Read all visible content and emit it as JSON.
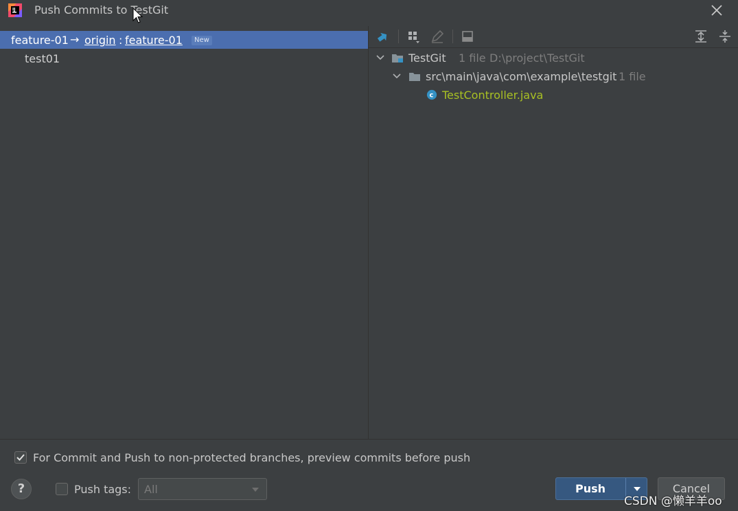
{
  "window": {
    "title": "Push Commits to TestGit",
    "close_icon": "close-icon",
    "app_icon": "intellij-idea-icon"
  },
  "commits_panel": {
    "branch": {
      "local": "feature-01",
      "arrow": "→",
      "remote": "origin",
      "separator": ":",
      "target": "feature-01",
      "badge": "New"
    },
    "commits": [
      "test01"
    ]
  },
  "changes_panel": {
    "toolbar_icons": [
      "show-diff-icon",
      "group-by-icon",
      "edit-source-icon",
      "view-options-icon",
      "expand-all-icon",
      "collapse-all-icon"
    ],
    "tree": {
      "root": {
        "name": "TestGit",
        "count": "1 file",
        "path": "D:\\project\\TestGit"
      },
      "dir": {
        "name": "src\\main\\java\\com\\example\\testgit",
        "count": "1 file"
      },
      "file": {
        "name": "TestController.java",
        "color": "#a8c023"
      }
    }
  },
  "bottom": {
    "preview_option": {
      "checked": true,
      "label": "For Commit and Push to non-protected branches, preview commits before push"
    },
    "help": "?",
    "push_tags": {
      "checked": false,
      "label": "Push tags:",
      "value": "All"
    },
    "push_label": "Push",
    "cancel_label": "Cancel"
  },
  "watermark": "CSDN @懒羊羊oo",
  "colors": {
    "background": "#3c3f41",
    "selection": "#4b6eaf",
    "primary_button": "#365880"
  }
}
